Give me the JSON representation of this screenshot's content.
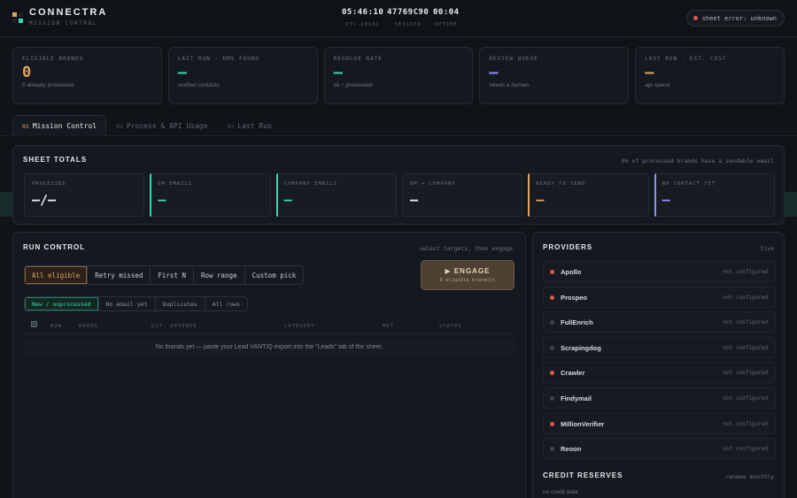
{
  "app": {
    "name": "CONNECTRA",
    "subtitle": "MISSION CONTROL",
    "colors": {
      "accent": "#e2a361",
      "teal": "#3fd3b0",
      "violet": "#8f8ff0",
      "error": "#e5534b"
    }
  },
  "header": {
    "clocks": [
      {
        "value": "05:46:10",
        "label": "UTC-LOCAL"
      },
      {
        "value": "47769C90",
        "label": "SESSION"
      },
      {
        "value": "00:04",
        "label": "UPTIME"
      }
    ],
    "status": {
      "text": "sheet error: unknown",
      "color": "#e5534b"
    }
  },
  "kpis": [
    {
      "label": "ELIGIBLE BRANDS",
      "value": "0",
      "sub": "0 already processed",
      "color": "#e2a361"
    },
    {
      "label": "LAST RUN · DMS FOUND",
      "value": "—",
      "sub": "verified contacts",
      "color": "#3fd3b0"
    },
    {
      "label": "RESOLVE RATE",
      "value": "—",
      "sub": "ok ÷ processed",
      "color": "#3fd3b0"
    },
    {
      "label": "REVIEW QUEUE",
      "value": "—",
      "sub": "needs a human",
      "color": "#8f8ff0"
    },
    {
      "label": "LAST RUN · EST. COST",
      "value": "—",
      "sub": "api spend",
      "color": "#e2a361"
    }
  ],
  "tabs": [
    {
      "num": "01",
      "label": "Mission Control",
      "active": true
    },
    {
      "num": "02",
      "label": "Process & API Usage",
      "active": false
    },
    {
      "num": "03",
      "label": "Last Run",
      "active": false
    }
  ],
  "totals": {
    "title": "SHEET TOTALS",
    "note": "0% of processed brands have a sendable email",
    "cells": [
      {
        "label": "PROCESSED",
        "value": "—/—",
        "bar": ""
      },
      {
        "label": "DM EMAILS",
        "value": "—",
        "bar": "#3fd3b0"
      },
      {
        "label": "COMPANY EMAILS",
        "value": "—",
        "bar": "#3fd3b0"
      },
      {
        "label": "DM + COMPANY",
        "value": "—",
        "bar": ""
      },
      {
        "label": "READY TO SEND",
        "value": "—",
        "bar": "#e2a361"
      },
      {
        "label": "NO CONTACT YET",
        "value": "—",
        "bar": "#8f8ff0"
      }
    ]
  },
  "run": {
    "title": "RUN CONTROL",
    "note": "select targets, then engage",
    "modes": [
      "All eligible",
      "Retry missed",
      "First N",
      "Row range",
      "Custom pick"
    ],
    "filters": [
      "New / unprocessed",
      "No email yet",
      "Duplicates",
      "All rows"
    ],
    "engage": {
      "label": "▶ ENGAGE",
      "sub": "0 eligible brand(s)"
    },
    "columns": [
      "ROW",
      "BRAND",
      "EST. REVENUE",
      "CATEGORY",
      "MKT",
      "STATUS"
    ],
    "empty": "No brands yet — paste your Lead VANTIQ export into the \"Leads\" tab of the sheet."
  },
  "providers": {
    "title": "PROVIDERS",
    "note": "live",
    "items": [
      {
        "name": "Apollo",
        "status": "not configured",
        "dot": "#e5534b"
      },
      {
        "name": "Prospeo",
        "status": "not configured",
        "dot": "#e5534b"
      },
      {
        "name": "FullEnrich",
        "status": "not configured",
        "dot": "#3a424c"
      },
      {
        "name": "Scrapingdog",
        "status": "not configured",
        "dot": "#3a424c"
      },
      {
        "name": "Crawler",
        "status": "not configured",
        "dot": "#e5534b"
      },
      {
        "name": "Findymail",
        "status": "not configured",
        "dot": "#3a424c"
      },
      {
        "name": "MillionVerifier",
        "status": "not configured",
        "dot": "#e5534b"
      },
      {
        "name": "Reoon",
        "status": "not configured",
        "dot": "#3a424c"
      }
    ],
    "credit_title": "CREDIT RESERVES",
    "credit_note": "renews monthly",
    "credit_empty": "no credit data"
  }
}
